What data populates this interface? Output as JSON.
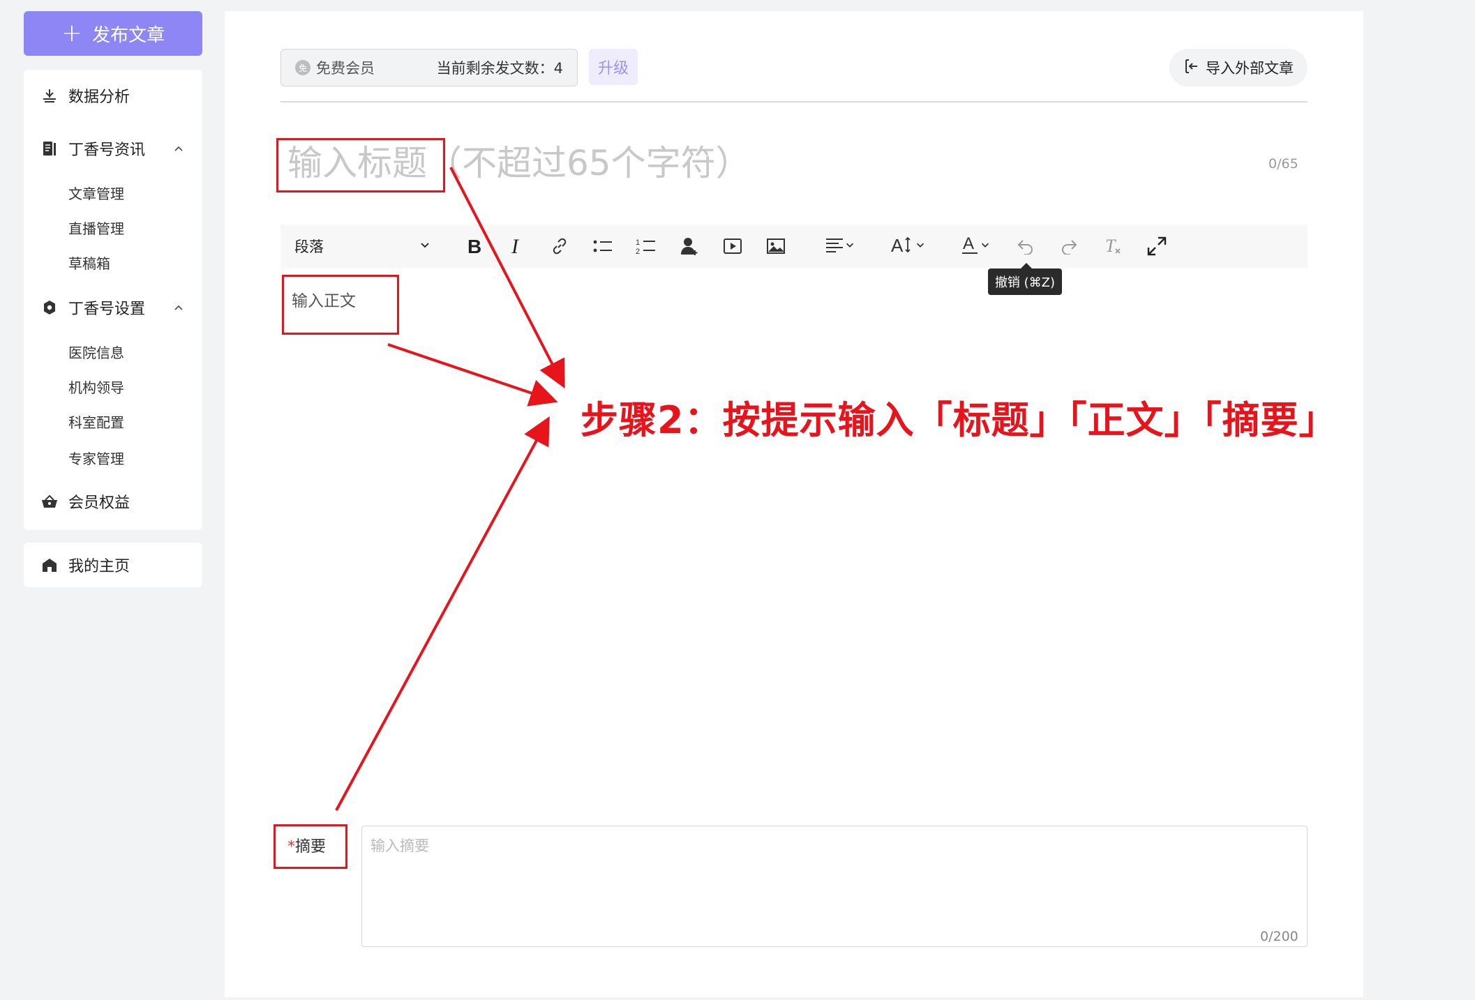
{
  "sidebar": {
    "publish_label": "发布文章",
    "nav": {
      "data_analysis": "数据分析",
      "news_group": "丁香号资讯",
      "news_items": [
        "文章管理",
        "直播管理",
        "草稿箱"
      ],
      "settings_group": "丁香号设置",
      "settings_items": [
        "医院信息",
        "机构领导",
        "科室配置",
        "专家管理"
      ],
      "member_rights": "会员权益"
    },
    "homepage": "我的主页"
  },
  "header": {
    "member_badge": "免",
    "member_type": "免费会员",
    "remaining": "当前剩余发文数：4",
    "upgrade_label": "升级",
    "import_label": "导入外部文章"
  },
  "editor": {
    "title_placeholder": "输入标题（不超过65个字符）",
    "title_count": "0/65",
    "toolbar": {
      "paragraph_label": "段落",
      "undo_tooltip": "撤销 (⌘Z)"
    },
    "body_placeholder": "输入正文"
  },
  "summary": {
    "required_mark": "*",
    "label": "摘要",
    "placeholder": "输入摘要",
    "count": "0/200"
  },
  "annotation": {
    "step_text": "步骤2：按提示输入「标题」「正文」「摘要」",
    "color": "#e8141c"
  },
  "colors": {
    "accent": "#8f86f5",
    "upgrade_text": "#9b93f3",
    "upgrade_bg": "#eeecfd"
  }
}
